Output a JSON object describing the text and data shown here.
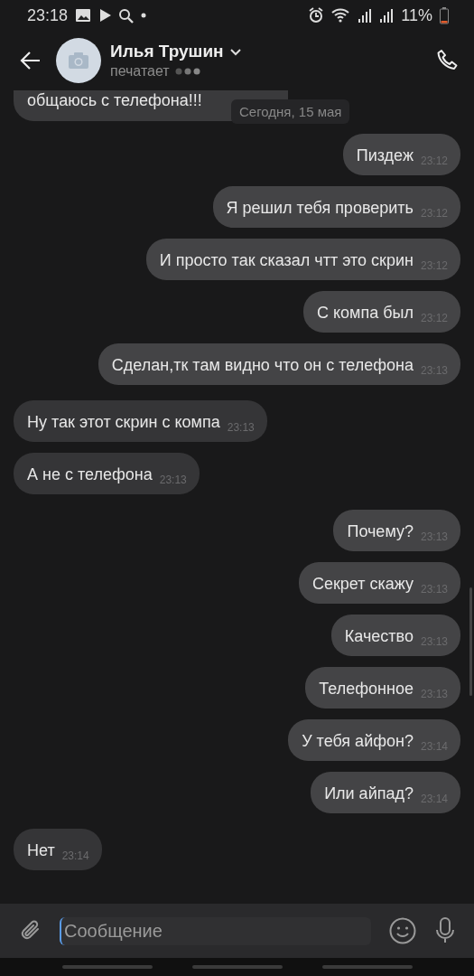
{
  "status_bar": {
    "time": "23:18",
    "battery": "11%"
  },
  "header": {
    "name": "Илья Трушин",
    "status": "печатает"
  },
  "top_message": {
    "text": "общаюсь с телефона!!!"
  },
  "date_pill": "Сегодня, 15 мая",
  "messages": [
    {
      "text": "Пиздеж",
      "time": "23:12",
      "outgoing": true
    },
    {
      "text": "Я решил тебя проверить",
      "time": "23:12",
      "outgoing": true
    },
    {
      "text": "И просто так сказал чтт это скрин",
      "time": "23:12",
      "outgoing": true
    },
    {
      "text": "С компа был",
      "time": "23:12",
      "outgoing": true
    },
    {
      "text": "Сделан,тк там видно что он с телефона",
      "time": "23:13",
      "outgoing": true
    },
    {
      "text": "Ну так этот скрин с компа",
      "time": "23:13",
      "outgoing": false
    },
    {
      "text": "А не с телефона",
      "time": "23:13",
      "outgoing": false
    },
    {
      "text": "Почему?",
      "time": "23:13",
      "outgoing": true
    },
    {
      "text": "Секрет скажу",
      "time": "23:13",
      "outgoing": true
    },
    {
      "text": "Качество",
      "time": "23:13",
      "outgoing": true
    },
    {
      "text": "Телефонное",
      "time": "23:13",
      "outgoing": true
    },
    {
      "text": "У тебя айфон?",
      "time": "23:14",
      "outgoing": true
    },
    {
      "text": "Или айпад?",
      "time": "23:14",
      "outgoing": true
    },
    {
      "text": "Нет",
      "time": "23:14",
      "outgoing": false
    }
  ],
  "composer": {
    "placeholder": "Сообщение"
  }
}
